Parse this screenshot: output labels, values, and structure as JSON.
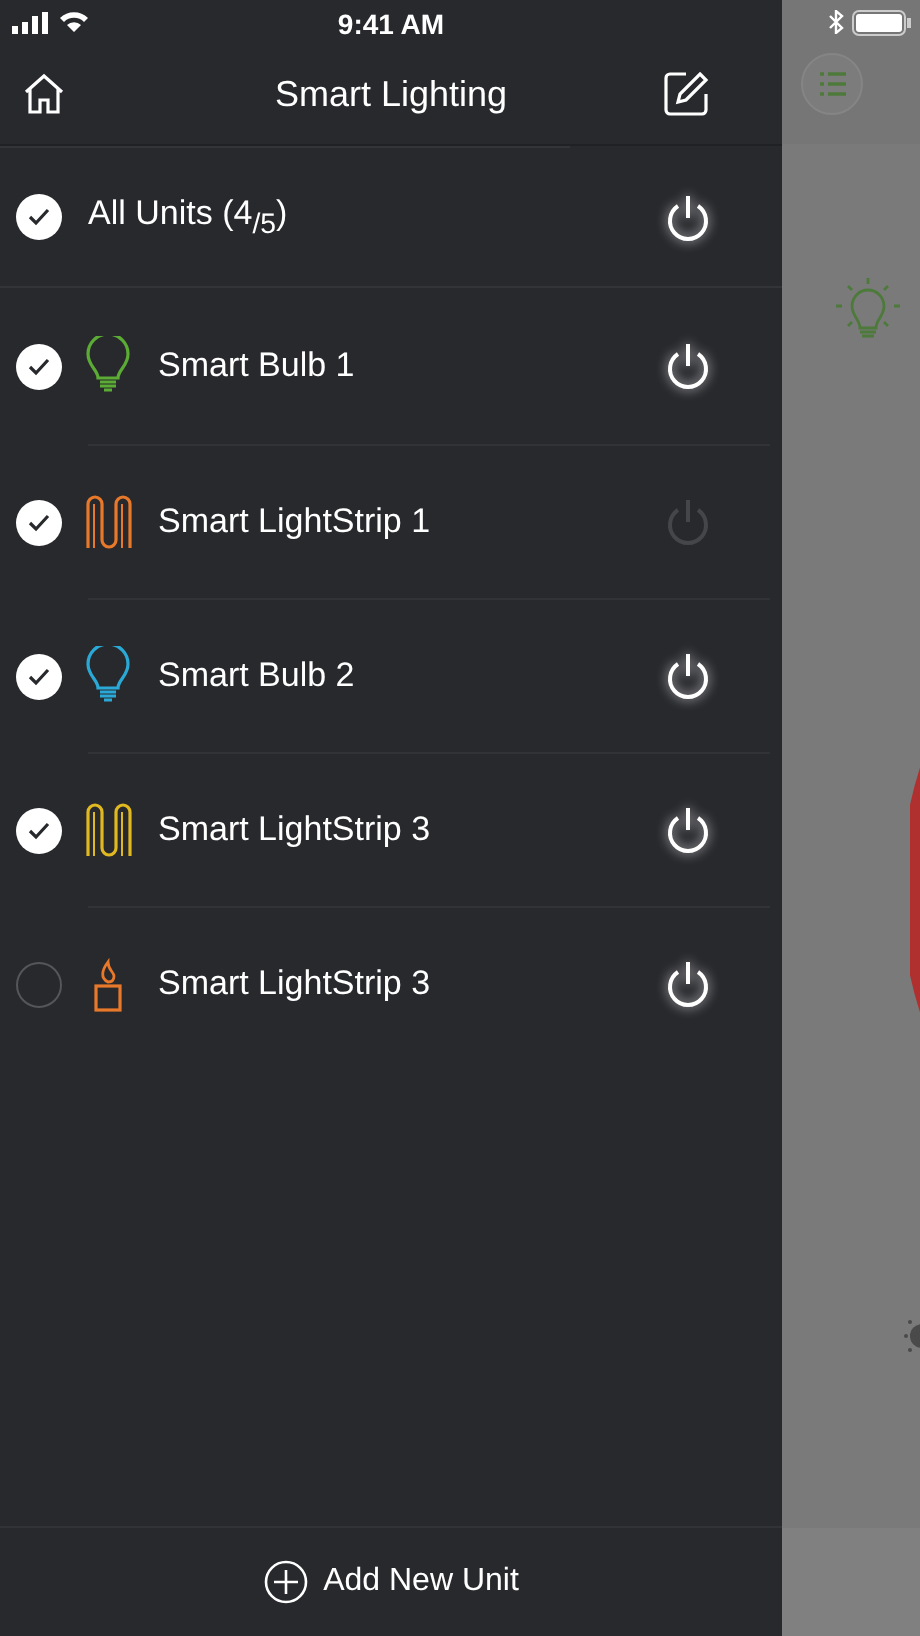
{
  "status_bar": {
    "time": "9:41 AM"
  },
  "header": {
    "title": "Smart Lighting"
  },
  "all_units": {
    "label": "All Units (4$_{/5}$)",
    "checked": true,
    "on": true
  },
  "units": [
    {
      "name": "Smart Bulb 1",
      "kind": "bulb",
      "color": "#5bab35",
      "checked": true,
      "on": true
    },
    {
      "name": "Smart LightStrip 1",
      "kind": "strip",
      "color": "#e8782a",
      "checked": true,
      "on": false
    },
    {
      "name": "Smart Bulb 2",
      "kind": "bulb",
      "color": "#2aa9d6",
      "checked": true,
      "on": true
    },
    {
      "name": "Smart LightStrip 3",
      "kind": "strip",
      "color": "#e0b820",
      "checked": true,
      "on": true
    },
    {
      "name": "Smart LightStrip 3",
      "kind": "candle",
      "color": "#e8782a",
      "checked": false,
      "on": true
    }
  ],
  "footer": {
    "label": "Add New Unit"
  }
}
